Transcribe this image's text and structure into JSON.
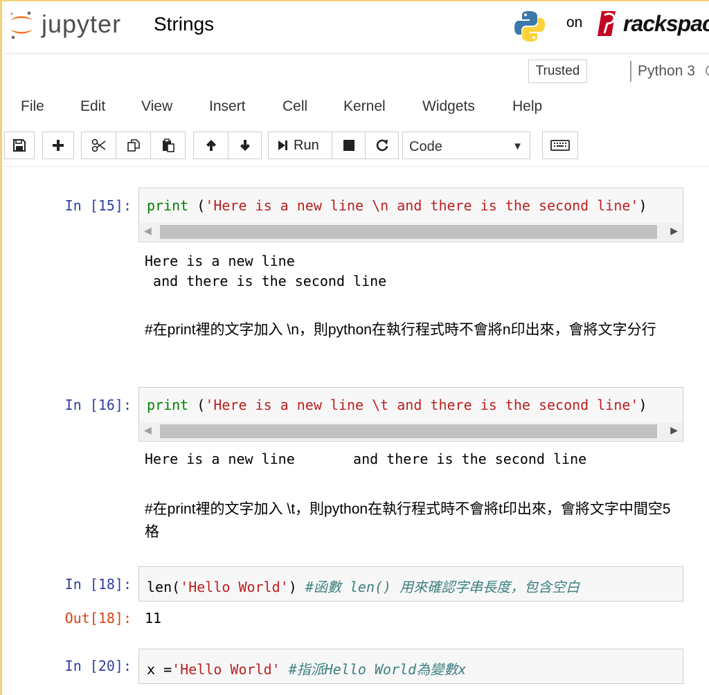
{
  "header": {
    "logo_text": "jupyter",
    "notebook_name": "Strings",
    "on_text": "on",
    "host_text": "rackspace"
  },
  "status": {
    "trusted_label": "Trusted",
    "kernel_name": "Python 3"
  },
  "menu": [
    "File",
    "Edit",
    "View",
    "Insert",
    "Cell",
    "Kernel",
    "Widgets",
    "Help"
  ],
  "toolbar": {
    "run_label": "Run",
    "cell_type": "Code",
    "icons": [
      "save-icon",
      "plus-icon",
      "cut-icon",
      "copy-icon",
      "paste-icon",
      "arrow-up-icon",
      "arrow-down-icon",
      "run-icon",
      "stop-icon",
      "restart-icon",
      "chevron-down-icon",
      "keyboard-icon"
    ]
  },
  "cells": {
    "c15": {
      "prompt": "In [15]:",
      "code_kw": "print",
      "code_open": " (",
      "code_str": "'Here is a new line \\n and there is the second line'",
      "code_close": ")",
      "output": "Here is a new line\n and there is the second line"
    },
    "md1": {
      "text": "#在print裡的文字加入 \\n，則python在執行程式時不會將n印出來，會將文字分行"
    },
    "c16": {
      "prompt": "In [16]:",
      "code_kw": "print",
      "code_open": " (",
      "code_str": "'Here is a new line \\t and there is the second line'",
      "code_close": ")",
      "output": "Here is a new line\t and there is the second line"
    },
    "md2": {
      "text": "#在print裡的文字加入 \\t，則python在執行程式時不會將t印出來，會將文字中間空5格"
    },
    "c18": {
      "prompt": "In [18]:",
      "code_fn": "len(",
      "code_str": "'Hello World'",
      "code_close": ") ",
      "code_cmt": "#函數 len() 用來確認字串長度，包含空白",
      "out_prompt": "Out[18]:",
      "output": "11"
    },
    "c20": {
      "prompt": "In [20]:",
      "code_var": "x =",
      "code_str": "'Hello World'",
      "code_cmt": " #指派Hello World為變數x"
    }
  }
}
